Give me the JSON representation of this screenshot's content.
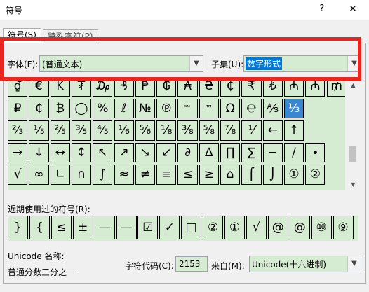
{
  "window": {
    "title": "符号",
    "help": "?",
    "close": "✕"
  },
  "tabs": [
    {
      "label": "符号(S)"
    },
    {
      "label": "特殊字符(P)"
    }
  ],
  "font": {
    "label": "字体(F):",
    "value": "(普通文本)"
  },
  "subset": {
    "label": "子集(U):",
    "value": "数字形式"
  },
  "symbols": [
    [
      "₫",
      "€",
      "₭",
      "₮",
      "₯",
      "₰",
      "₱",
      "₲",
      "₳",
      "₴",
      "₵",
      "₹",
      "₺",
      "₼",
      "₼",
      "₥"
    ],
    [
      "₽",
      "₵",
      "₿",
      "◯",
      "%",
      "ℓ",
      "№",
      "℗",
      "℠",
      "™",
      "Ω",
      "℮",
      "⅍",
      "⅓"
    ],
    [
      "⅔",
      "⅕",
      "⅖",
      "⅗",
      "⅘",
      "⅙",
      "⅚",
      "⅛",
      "⅜",
      "⅝",
      "⅞",
      "⅟",
      "←",
      "↑"
    ],
    [
      "→",
      "↓",
      "↔",
      "↕",
      "↖",
      "↗",
      "↘",
      "↙",
      "∂",
      "∆",
      "∏",
      "∑",
      "−",
      "∕",
      "∙"
    ],
    [
      "√",
      "∞",
      "∟",
      "∩",
      "∫",
      "≈",
      "≠",
      "≡",
      "≤",
      "≥",
      "⌂",
      "⌠",
      "⌡",
      "①",
      "②"
    ]
  ],
  "selected_symbol": "⅓",
  "recent": {
    "label": "近期使用过的符号(R):",
    "items": [
      "}",
      "{",
      "≤",
      "±",
      "—",
      "—",
      "☑",
      "✓",
      "□",
      "②",
      "①",
      "√",
      "@",
      "@",
      "⑩",
      "⑨"
    ]
  },
  "unicode_name": {
    "label": "Unicode 名称:",
    "value": "普通分数三分之一"
  },
  "char_code": {
    "label": "字符代码(C):",
    "value": "2153"
  },
  "from": {
    "label": "来自(M):",
    "value": "Unicode(十六进制)"
  }
}
